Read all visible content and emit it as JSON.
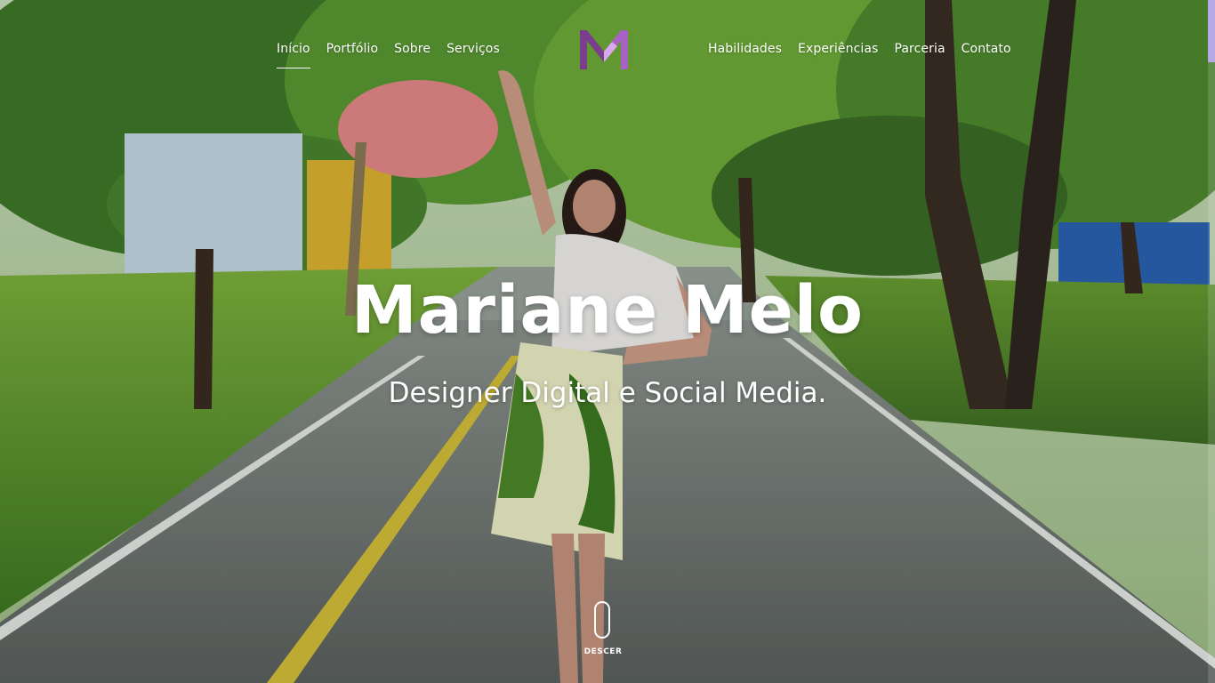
{
  "nav": {
    "left": [
      "Início",
      "Portfólio",
      "Sobre",
      "Serviços"
    ],
    "right": [
      "Habilidades",
      "Experiências",
      "Parceria",
      "Contato"
    ],
    "active": "Início"
  },
  "logo": {
    "icon": "m-monogram-logo",
    "colors": [
      "#7a3e8c",
      "#c98be0"
    ]
  },
  "hero": {
    "title": "Mariane Melo",
    "subtitle": "Designer Digital e Social Media."
  },
  "scroll": {
    "label": "DESCER",
    "icon": "mouse-scroll-icon"
  },
  "colors": {
    "accent": "#8e4fa6",
    "text": "#ffffff"
  }
}
